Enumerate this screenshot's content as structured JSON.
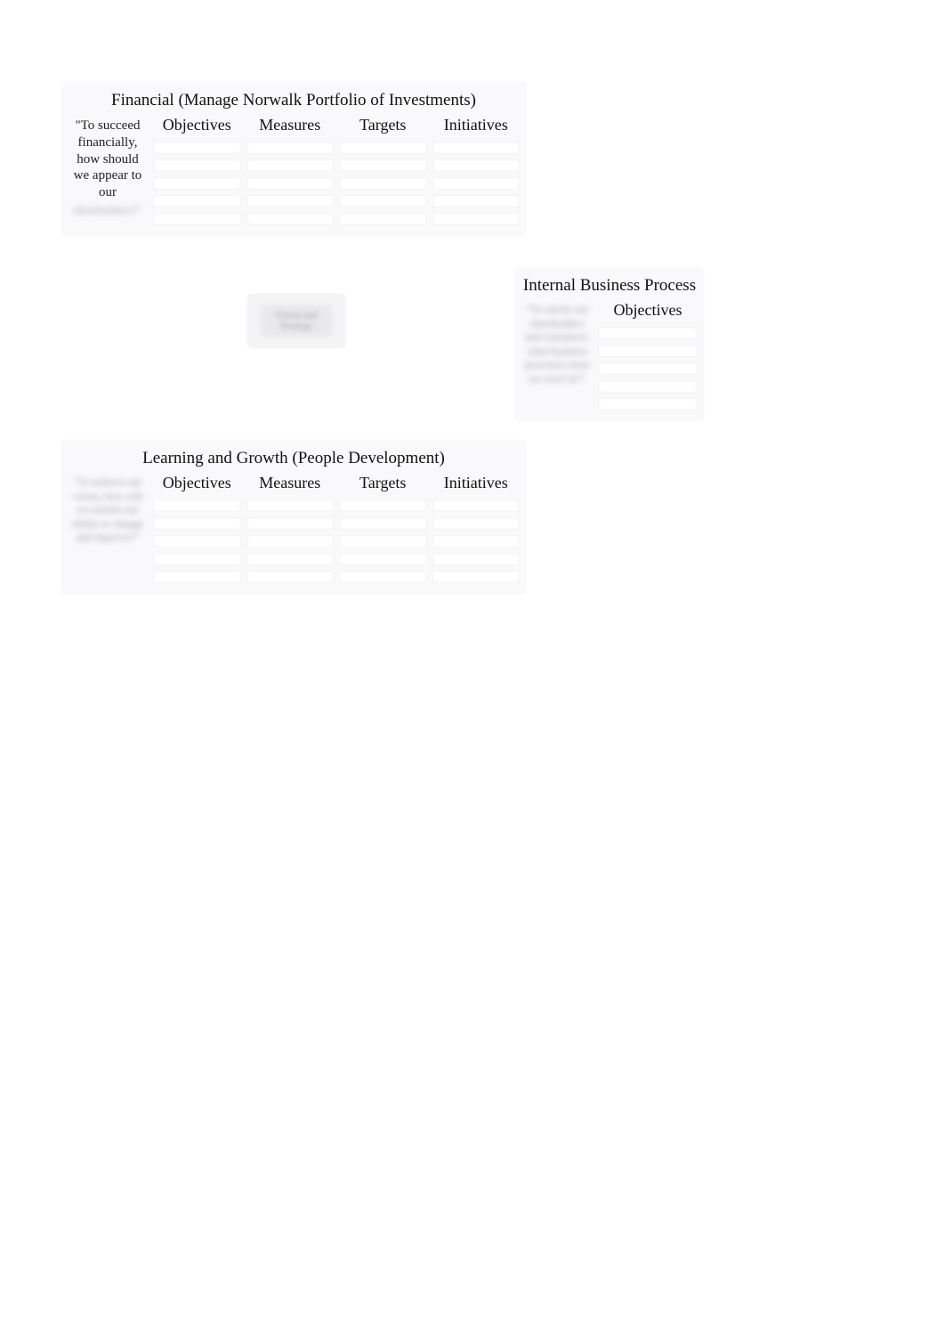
{
  "financial": {
    "title": "Financial (Manage Norwalk Portfolio of Investments)",
    "question_visible": "\"To succeed financially, how should we appear to our",
    "question_blurred": "shareholders?\"",
    "columns": [
      "Objectives",
      "Measures",
      "Targets",
      "Initiatives"
    ],
    "rows": 5
  },
  "vision": {
    "blurred_text": "Vision and Strategy"
  },
  "internal": {
    "title": "Internal Business Process",
    "question_blurred": "\"To satisfy our shareholders and customers, what business processes must we excel at?\"",
    "columns_visible": [
      "Objectives"
    ],
    "rows": 5
  },
  "learning": {
    "title": "Learning and Growth (People Development)",
    "question_blurred": "\"To achieve our vision, how will we sustain our ability to change and improve?\"",
    "columns": [
      "Objectives",
      "Measures",
      "Targets",
      "Initiatives"
    ],
    "rows": 5
  }
}
